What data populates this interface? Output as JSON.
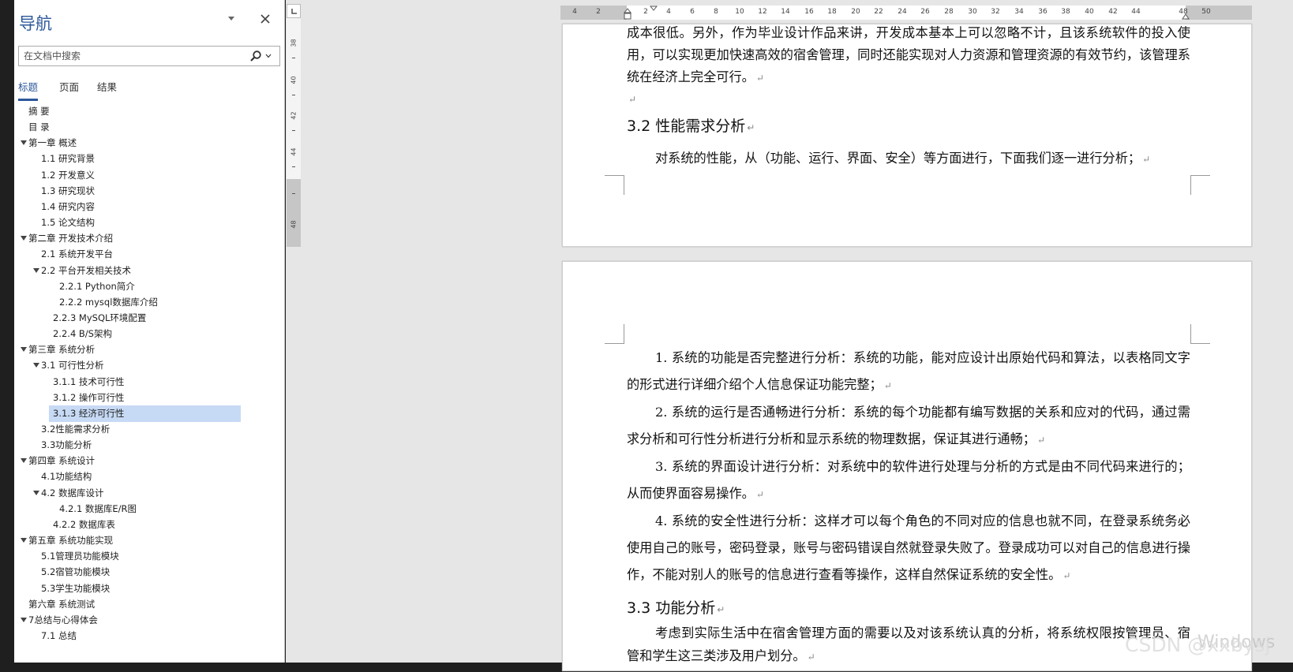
{
  "nav": {
    "title": "导航",
    "search_placeholder": "在文档中搜索",
    "tabs": [
      "标题",
      "页面",
      "结果"
    ],
    "tree": [
      {
        "label": "摘  要",
        "level": 1,
        "arrow": false,
        "selected": false
      },
      {
        "label": "目  录",
        "level": 1,
        "arrow": false,
        "selected": false
      },
      {
        "label": "第一章 概述",
        "level": 1,
        "arrow": true,
        "selected": false
      },
      {
        "label": "1.1 研究背景",
        "level": 2,
        "arrow": false,
        "selected": false
      },
      {
        "label": "1.2 开发意义",
        "level": 2,
        "arrow": false,
        "selected": false
      },
      {
        "label": "1.3 研究现状",
        "level": 2,
        "arrow": false,
        "selected": false
      },
      {
        "label": "1.4 研究内容",
        "level": 2,
        "arrow": false,
        "selected": false
      },
      {
        "label": "1.5 论文结构",
        "level": 2,
        "arrow": false,
        "selected": false
      },
      {
        "label": " 第二章 开发技术介绍",
        "level": 1,
        "arrow": true,
        "selected": false
      },
      {
        "label": "2.1 系统开发平台",
        "level": 2,
        "arrow": false,
        "selected": false
      },
      {
        "label": "2.2 平台开发相关技术",
        "level": 2,
        "arrow": true,
        "selected": false
      },
      {
        "label": "2.2.1  Python简介",
        "level": 4,
        "arrow": false,
        "selected": false
      },
      {
        "label": "2.2.2  mysql数据库介绍",
        "level": 4,
        "arrow": false,
        "selected": false
      },
      {
        "label": "2.2.3  MySQL环境配置",
        "level": 3,
        "arrow": false,
        "selected": false
      },
      {
        "label": "2.2.4  B/S架构",
        "level": 3,
        "arrow": false,
        "selected": false
      },
      {
        "label": "第三章 系统分析",
        "level": 1,
        "arrow": true,
        "selected": false
      },
      {
        "label": "3.1 可行性分析",
        "level": 2,
        "arrow": true,
        "selected": false
      },
      {
        "label": "3.1.1 技术可行性",
        "level": 3,
        "arrow": false,
        "selected": false
      },
      {
        "label": "3.1.2 操作可行性",
        "level": 3,
        "arrow": false,
        "selected": false
      },
      {
        "label": "3.1.3 经济可行性",
        "level": 3,
        "arrow": false,
        "selected": true
      },
      {
        "label": "3.2性能需求分析",
        "level": 2,
        "arrow": false,
        "selected": false
      },
      {
        "label": "3.3功能分析",
        "level": 2,
        "arrow": false,
        "selected": false
      },
      {
        "label": "第四章 系统设计",
        "level": 1,
        "arrow": true,
        "selected": false
      },
      {
        "label": "4.1功能结构",
        "level": 2,
        "arrow": false,
        "selected": false
      },
      {
        "label": "4.2 数据库设计",
        "level": 2,
        "arrow": true,
        "selected": false
      },
      {
        "label": "4.2.1 数据库E/R图",
        "level": 4,
        "arrow": false,
        "selected": false
      },
      {
        "label": "4.2.2 数据库表",
        "level": 3,
        "arrow": false,
        "selected": false
      },
      {
        "label": "第五章 系统功能实现",
        "level": 1,
        "arrow": true,
        "selected": false
      },
      {
        "label": "5.1管理员功能模块",
        "level": 2,
        "arrow": false,
        "selected": false
      },
      {
        "label": "5.2宿管功能模块",
        "level": 2,
        "arrow": false,
        "selected": false
      },
      {
        "label": "5.3学生功能模块",
        "level": 2,
        "arrow": false,
        "selected": false
      },
      {
        "label": "第六章 系统测试",
        "level": 1,
        "arrow": false,
        "selected": false
      },
      {
        "label": "7总结与心得体会",
        "level": 1,
        "arrow": true,
        "selected": false
      },
      {
        "label": "7.1 总结",
        "level": 2,
        "arrow": false,
        "selected": false
      }
    ]
  },
  "vruler": {
    "numbers": [
      "38",
      "40",
      "42",
      "44",
      "48"
    ]
  },
  "hruler": {
    "numbers": [
      "4",
      "2",
      "2",
      "4",
      "6",
      "8",
      "10",
      "12",
      "14",
      "16",
      "18",
      "20",
      "22",
      "24",
      "26",
      "28",
      "30",
      "32",
      "34",
      "36",
      "38",
      "40",
      "42",
      "44",
      "48",
      "50"
    ]
  },
  "page1": {
    "para1": "成本很低。另外，作为毕业设计作品来讲，开发成本基本上可以忽略不计，且该系统软件的投入使用，可以实现更加快速高效的宿舍管理，同时还能实现对人力资源和管理资源的有效节约，该管理系统在经济上完全可行。",
    "heading": "3.2 性能需求分析",
    "para2": "对系统的性能，从（功能、运行、界面、安全）等方面进行，下面我们逐一进行分析；"
  },
  "page2": {
    "items": [
      "1. 系统的功能是否完整进行分析：系统的功能，能对应设计出原始代码和算法，以表格同文字的形式进行详细介绍个人信息保证功能完整；",
      "2. 系统的运行是否通畅进行分析：系统的每个功能都有编写数据的关系和应对的代码，通过需求分析和可行性分析进行分析和显示系统的物理数据，保证其进行通畅；",
      "3. 系统的界面设计进行分析：对系统中的软件进行处理与分析的方式是由不同代码来进行的；从而使界面容易操作。",
      "4. 系统的安全性进行分析：这样才可以每个角色的不同对应的信息也就不同，在登录系统务必使用自己的账号，密码登录，账号与密码错误自然就登录失败了。登录成功可以对自己的信息进行操作，不能对别人的账号的信息进行查看等操作，这样自然保证系统的安全性。"
    ],
    "heading": "3.3 功能分析",
    "para": "考虑到实际生活中在宿舍管理方面的需要以及对该系统认真的分析，将系统权限按管理员、宿管和学生这三类涉及用户划分。"
  },
  "watermark": "CSDN @xxbysj",
  "os_watermark": "Windows"
}
